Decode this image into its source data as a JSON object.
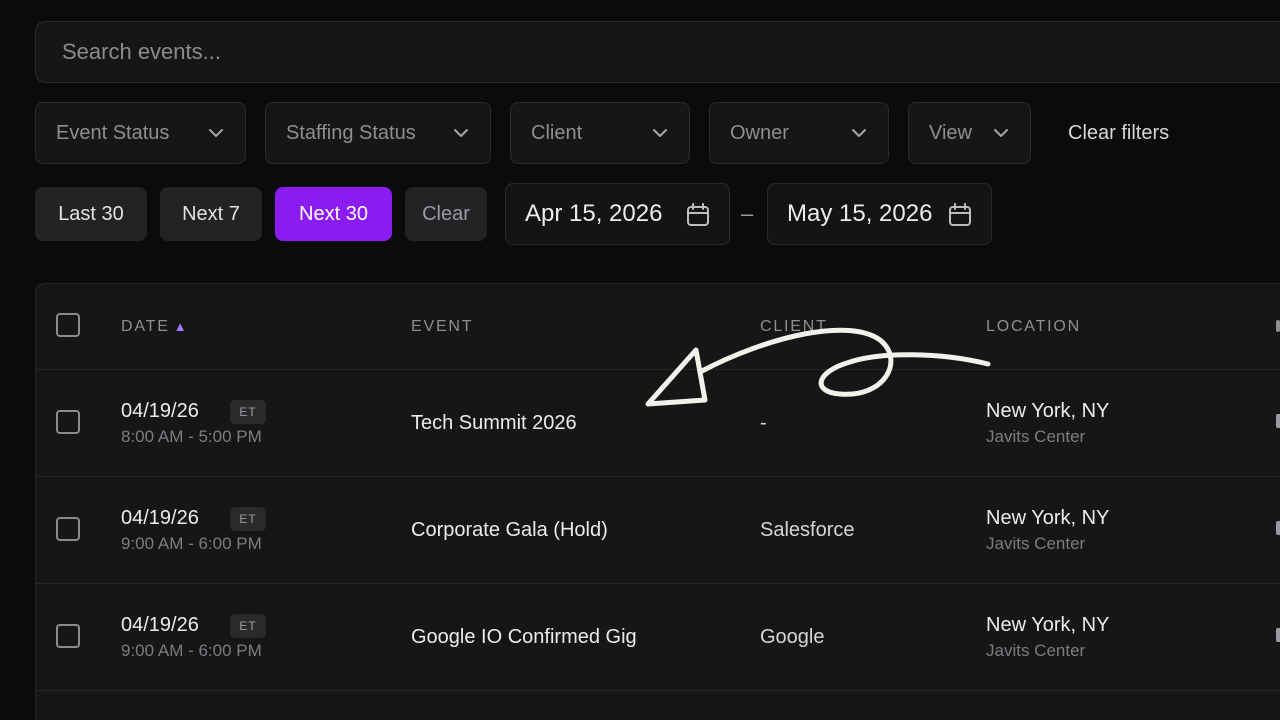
{
  "search": {
    "placeholder": "Search events..."
  },
  "filters": {
    "event_status": "Event Status",
    "staffing_status": "Staffing Status",
    "client": "Client",
    "owner": "Owner",
    "view": "View",
    "clear_filters": "Clear filters"
  },
  "quick_ranges": {
    "last30": "Last 30",
    "next7": "Next 7",
    "next30": "Next 30",
    "clear": "Clear",
    "active": "Next 30"
  },
  "date_range": {
    "start": "Apr 15, 2026",
    "separator": "–",
    "end": "May 15, 2026"
  },
  "table": {
    "columns": {
      "date": "DATE",
      "event": "EVENT",
      "client": "CLIENT",
      "location": "LOCATION"
    },
    "sort_column": "DATE",
    "sort_direction": "ascending",
    "rows": [
      {
        "date": "04/19/26",
        "tz": "ET",
        "time": "8:00 AM - 5:00 PM",
        "event": "Tech Summit 2026",
        "client": "-",
        "city": "New York, NY",
        "venue": "Javits Center"
      },
      {
        "date": "04/19/26",
        "tz": "ET",
        "time": "9:00 AM - 6:00 PM",
        "event": "Corporate Gala (Hold)",
        "client": "Salesforce",
        "city": "New York, NY",
        "venue": "Javits Center"
      },
      {
        "date": "04/19/26",
        "tz": "ET",
        "time": "9:00 AM - 6:00 PM",
        "event": "Google IO Confirmed Gig",
        "client": "Google",
        "city": "New York, NY",
        "venue": "Javits Center"
      }
    ]
  },
  "colors": {
    "accent": "#8a1cf2",
    "background": "#0b0b0c",
    "panel": "#161617",
    "sort_indicator": "#a47cff"
  },
  "icons": [
    "chevron-down-icon",
    "calendar-icon",
    "sort-up-icon",
    "arrow-annotation"
  ]
}
